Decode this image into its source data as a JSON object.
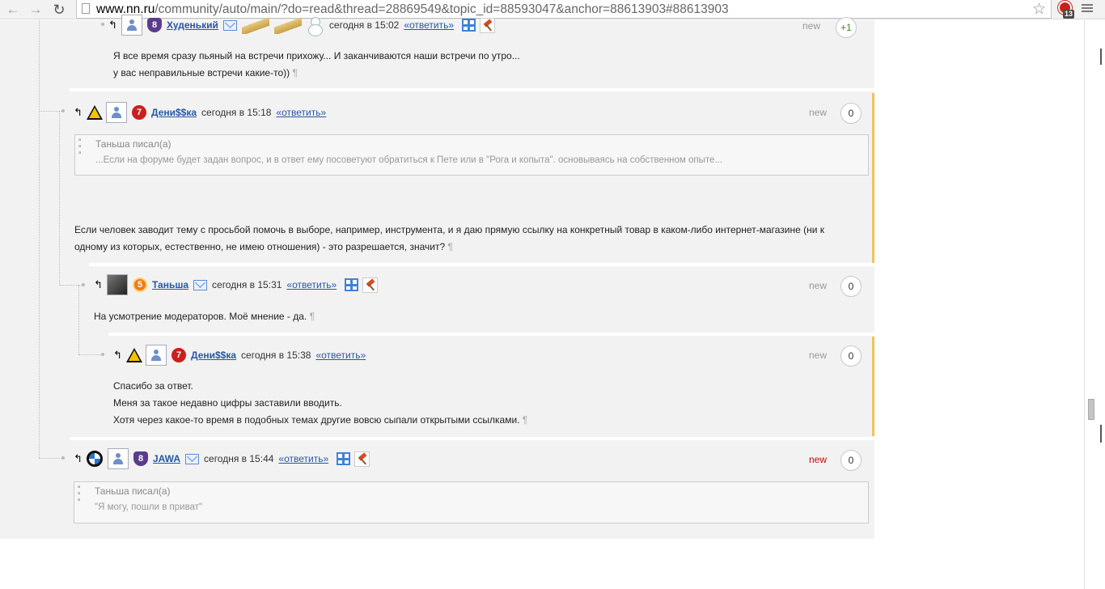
{
  "browser": {
    "url_host": "www.nn.ru",
    "url_path": "/community/auto/main/?do=read&thread=28869549&topic_id=88593047&anchor=88613903#88613903",
    "ext_badge": "13",
    "icons": [
      "back-icon",
      "forward-icon",
      "reload-icon",
      "page-icon",
      "star-icon",
      "adblock-icon",
      "menu-icon"
    ]
  },
  "posts": [
    {
      "id": "p1",
      "user": "Худенький",
      "time": "сегодня в 15:02",
      "reply": "«ответить»",
      "new": "new",
      "vote": "+1",
      "rank": "8",
      "lines": [
        "Я все время сразу пьяный на встречи прихожу... И заканчиваются наши встречи по утро...",
        "у вас неправильные встречи какие-то))"
      ]
    },
    {
      "id": "p2",
      "user": "Дени$$ка",
      "time": "сегодня в 15:18",
      "reply": "«ответить»",
      "new": "new",
      "vote": "0",
      "rank": "7",
      "quote_author": "Таньша писал(а)",
      "quote_text": "...Если на форуме будет задан вопрос, и в ответ ему посоветуют обратиться к Пете или в \"Рога и копыта\". основываясь на собственном опыте...",
      "text": "Если человек заводит тему с просьбой помочь в выборе, например, инструмента, и я даю прямую ссылку на конкретный товар в каком-либо интернет-магазине (ни к одному из которых, естественно, не имею отношения) - это разрешается, значит?"
    },
    {
      "id": "p3",
      "user": "Таньша",
      "time": "сегодня в 15:31",
      "reply": "«ответить»",
      "new": "new",
      "vote": "0",
      "rank": "5",
      "text": "На усмотрение модераторов. Моё мнение - да."
    },
    {
      "id": "p4",
      "user": "Дени$$ка",
      "time": "сегодня в 15:38",
      "reply": "«ответить»",
      "new": "new",
      "vote": "0",
      "rank": "7",
      "lines": [
        "Спасибо за ответ.",
        "Меня за такое недавно цифры заставили вводить.",
        "Хотя через какое-то время в подобных темах другие вовсю сыпали открытыми ссылками."
      ]
    },
    {
      "id": "p5",
      "user": "JAWA",
      "time": "сегодня в 15:44",
      "reply": "«ответить»",
      "new": "new",
      "vote": "0",
      "rank": "8",
      "quote_author": "Таньша писал(а)",
      "quote_text": "\"Я могу, пошли в приват\""
    }
  ],
  "colors": {
    "link": "#2458a3",
    "highlight_border": "#f0c35a",
    "new_unread": "#cc0000",
    "area_bg": "#f2f2f2"
  },
  "pilcrow": "¶"
}
